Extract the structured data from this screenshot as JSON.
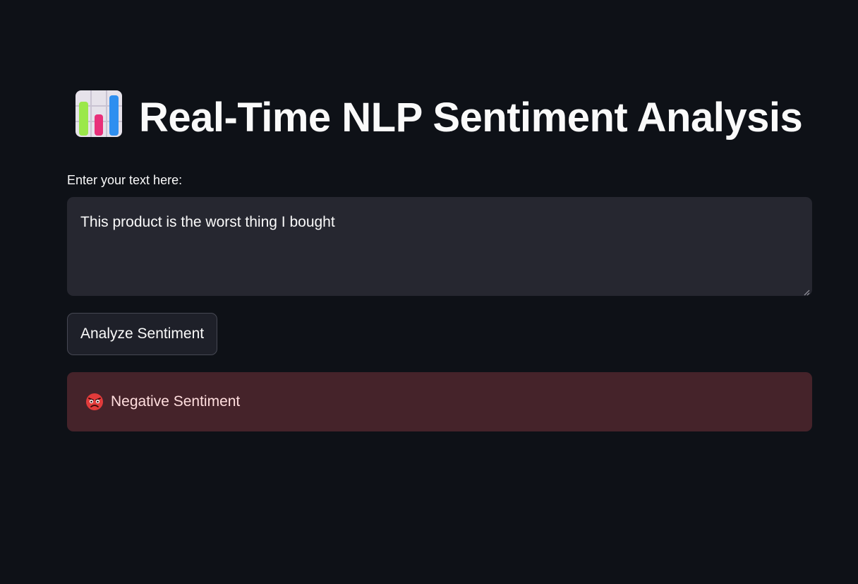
{
  "page": {
    "title": "Real-Time NLP Sentiment Analysis",
    "title_icon": "bar-chart-icon"
  },
  "input": {
    "label": "Enter your text here:",
    "value": "This product is the worst thing I bought"
  },
  "actions": {
    "analyze_label": "Analyze Sentiment"
  },
  "result": {
    "icon": "angry-face-icon",
    "text": "Negative Sentiment"
  },
  "colors": {
    "background": "#0e1117",
    "input_bg": "#262730",
    "error_bg": "#45232a",
    "error_text": "#ffdede"
  }
}
